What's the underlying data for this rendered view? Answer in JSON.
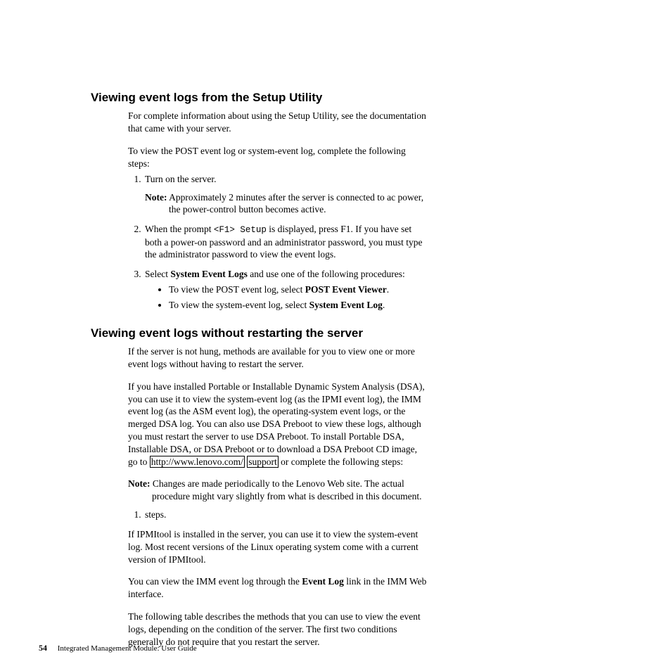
{
  "section1": {
    "heading": "Viewing event logs from the Setup Utility",
    "p1": "For complete information about using the Setup Utility, see the documentation that came with your server.",
    "p2": "To view the POST event log or system-event log, complete the following steps:",
    "step1": "Turn on the server.",
    "note_label": "Note:",
    "note1": "Approximately 2 minutes after the server is connected to ac power, the power-control button becomes active.",
    "step2a": "When the prompt ",
    "step2_mono": "<F1> Setup",
    "step2b": " is displayed, press F1. If you have set both a power-on password and an administrator password, you must type the administrator password to view the event logs.",
    "step3a": "Select ",
    "step3_bold": "System Event Logs",
    "step3b": " and use one of the following procedures:",
    "bullet1a": "To view the POST event log, select ",
    "bullet1_bold": "POST Event Viewer",
    "bullet1b": ".",
    "bullet2a": "To view the system-event log, select ",
    "bullet2_bold": "System Event Log",
    "bullet2b": "."
  },
  "section2": {
    "heading": "Viewing event logs without restarting the server",
    "p1": "If the server is not hung, methods are available for you to view one or more event logs without having to restart the server.",
    "p2a": "If you have installed Portable or Installable Dynamic System Analysis (DSA), you can use it to view the system-event log (as the IPMI event log), the IMM event log (as the ASM event log), the operating-system event logs, or the merged DSA log. You can also use DSA Preboot to view these logs, although you must restart the server to use DSA Preboot. To install Portable DSA, Installable DSA, or DSA Preboot or to download a DSA Preboot CD image, go to ",
    "link1": "http://www.lenovo.com/",
    "link2": "support",
    "p2b": " or complete the following steps:",
    "note_label": "Note:",
    "note2": "Changes are made periodically to the Lenovo Web site. The actual procedure might vary slightly from what is described in this document.",
    "step1": "steps.",
    "p3": "If IPMItool is installed in the server, you can use it to view the system-event log. Most recent versions of the Linux operating system come with a current version of IPMItool.",
    "p4a": "You can view the IMM event log through the ",
    "p4_bold": "Event Log",
    "p4b": " link in the IMM Web interface.",
    "p5": "The following table describes the methods that you can use to view the event logs, depending on the condition of the server. The first two conditions generally do not require that you restart the server."
  },
  "footer": {
    "page_number": "54",
    "doc_title": "Integrated Management Module:  User Guide"
  }
}
